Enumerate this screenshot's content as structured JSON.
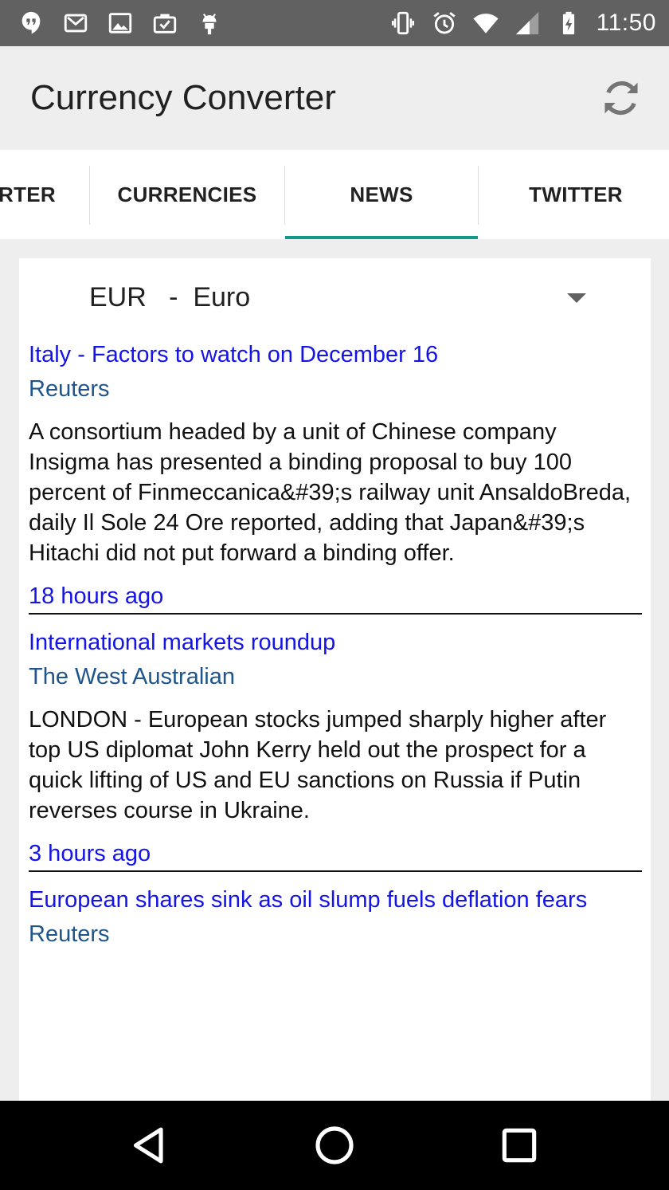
{
  "status_bar": {
    "time": "11:50",
    "left_icons": [
      "hangouts-icon",
      "gmail-icon",
      "image-icon",
      "briefcase-check-icon",
      "android-icon"
    ],
    "right_icons": [
      "vibrate-icon",
      "alarm-icon",
      "wifi-icon",
      "signal-icon",
      "battery-charging-icon"
    ]
  },
  "app_bar": {
    "title": "Currency Converter",
    "refresh_icon": "refresh-icon"
  },
  "tabs": [
    {
      "label": "CONVERTER",
      "visible_label": "ERTER",
      "active": false
    },
    {
      "label": "CURRENCIES",
      "active": false
    },
    {
      "label": "NEWS",
      "active": true
    },
    {
      "label": "TWITTER",
      "active": false
    }
  ],
  "colors": {
    "accent": "#14988a",
    "link": "#1414e6",
    "source": "#20558c",
    "status_bar": "#616161"
  },
  "currency_selector": {
    "selected": "EUR   -  Euro"
  },
  "news": [
    {
      "title": "Italy - Factors to watch on December 16",
      "source": "Reuters",
      "description": "A consortium headed by a unit of Chinese company Insigma has presented a binding proposal to buy 100 percent of Finmeccanica&#39;s railway unit AnsaldoBreda, daily Il Sole 24 Ore reported, adding that Japan&#39;s Hitachi did not put forward a binding offer.",
      "time": "18 hours ago"
    },
    {
      "title": "International markets roundup",
      "source": "The West Australian",
      "description": "LONDON - European stocks jumped sharply higher after top US diplomat John Kerry held out the prospect for a quick lifting of US and EU sanctions on Russia if Putin reverses course in Ukraine.",
      "time": "3 hours ago"
    },
    {
      "title": "European shares sink as oil slump fuels deflation fears",
      "source": "Reuters",
      "description": "",
      "time": ""
    }
  ],
  "nav_bar": {
    "back_icon": "back-icon",
    "home_icon": "home-icon",
    "recents_icon": "recents-icon"
  }
}
